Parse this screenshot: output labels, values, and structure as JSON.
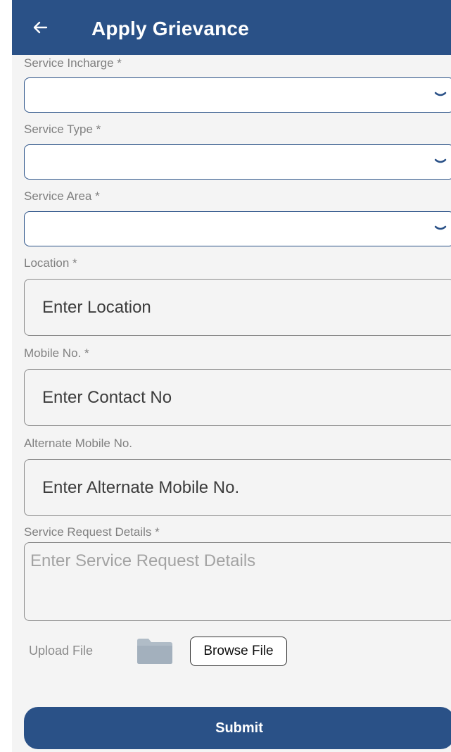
{
  "header": {
    "title": "Apply Grievance",
    "back_icon": "arrow-left-icon"
  },
  "form": {
    "service_incharge": {
      "label": "Service Incharge *",
      "value": ""
    },
    "service_type": {
      "label": "Service Type *",
      "value": ""
    },
    "service_area": {
      "label": "Service Area *",
      "value": ""
    },
    "location": {
      "label": "Location *",
      "placeholder": "Enter Location"
    },
    "mobile": {
      "label": "Mobile No. *",
      "placeholder": "Enter Contact No"
    },
    "alt_mobile": {
      "label": "Alternate Mobile No.",
      "placeholder": "Enter Alternate Mobile No."
    },
    "details": {
      "label": "Service Request Details *",
      "placeholder": "Enter Service Request Details"
    },
    "upload": {
      "label": "Upload File",
      "icon": "folder-icon",
      "browse_label": "Browse File"
    },
    "submit_label": "Submit"
  },
  "colors": {
    "primary": "#2a5187",
    "background": "#f4f4f4",
    "label": "#808080"
  }
}
